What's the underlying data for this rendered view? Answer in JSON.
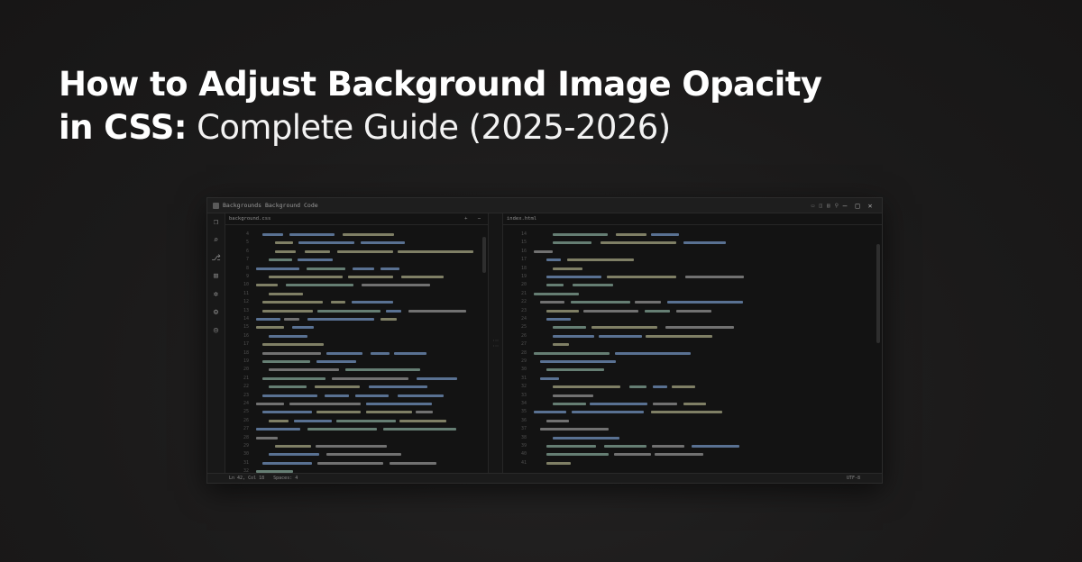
{
  "hero": {
    "title_bold_1": "How to Adjust Background Image Opacity",
    "title_bold_2": "in CSS:",
    "title_light_2": " Complete Guide (2025-2026)"
  },
  "editor": {
    "window_title": "Backgrounds Background Code",
    "left_tab": "background.css",
    "right_tab": "index.html",
    "left_start_line": 4,
    "right_start_line": 14,
    "status_left": "Ln 42, Col 18",
    "status_mid": "Spaces: 4",
    "status_right": "UTF-8"
  },
  "colors": {
    "keyword": "#6b8ab3",
    "string": "#9b9b7a",
    "plain": "#8a8a8a",
    "attr": "#7a9a8c"
  },
  "icons": [
    "files-icon",
    "search-icon",
    "source-control-icon",
    "extensions-icon",
    "debug-icon",
    "settings-icon",
    "account-icon"
  ]
}
